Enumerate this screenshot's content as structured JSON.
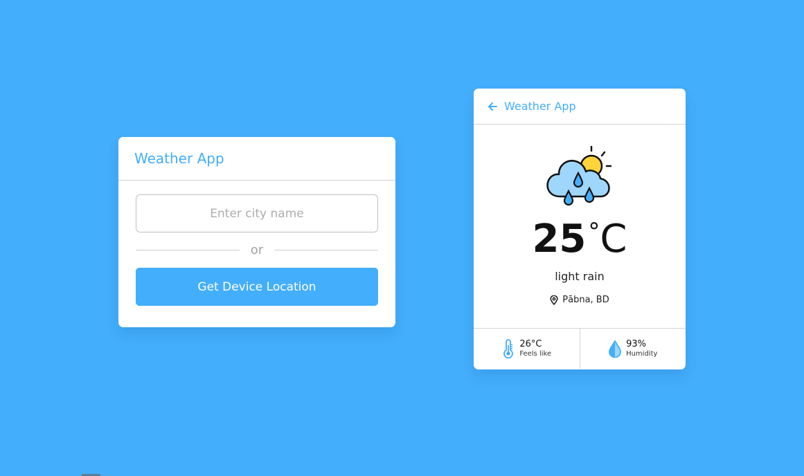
{
  "colors": {
    "background": "#43aefc",
    "accent": "#43aefc",
    "card": "#ffffff"
  },
  "search_card": {
    "title": "Weather App",
    "city_input": {
      "placeholder": "Enter city name",
      "value": ""
    },
    "separator_text": "or",
    "location_button_label": "Get Device Location"
  },
  "weather_card": {
    "title": "Weather App",
    "back_icon": "arrow-left-icon",
    "weather_icon": "cloud-rain-sun-icon",
    "temperature": "25",
    "degree_symbol": "°",
    "unit": "C",
    "description": "light rain",
    "location": "Pābna, BD",
    "location_icon": "map-pin-icon",
    "details": {
      "feels_like": {
        "value": "26°C",
        "label": "Feels like",
        "icon": "thermometer-icon"
      },
      "humidity": {
        "value": "93%",
        "label": "Humidity",
        "icon": "water-drop-icon"
      }
    }
  }
}
